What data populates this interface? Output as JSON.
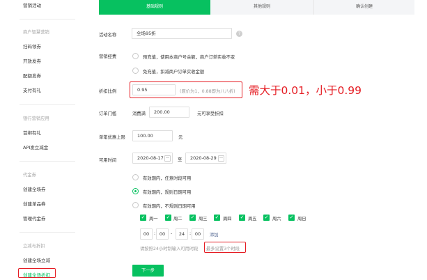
{
  "sidebar": {
    "top_item": "营销活动",
    "group1": {
      "title": "商户智慧营销",
      "items": [
        "扫码领券",
        "开放发券",
        "配额发券",
        "支付有礼"
      ]
    },
    "group2": {
      "title": "银行营销应用",
      "items": [
        "首绑有礼",
        "API发立减金"
      ]
    },
    "group3": {
      "title": "代金券",
      "items": [
        "创建全场券",
        "创建单品券",
        "管理代金券"
      ]
    },
    "group4": {
      "title": "立减与折扣",
      "items": [
        "创建全场立减",
        "创建全场折扣"
      ]
    }
  },
  "steps": [
    "基础规则",
    "其他规则",
    "确认创建"
  ],
  "form": {
    "activity_name": {
      "label": "活动名称",
      "value": "全场95折"
    },
    "funding": {
      "label": "营销经费",
      "options": [
        "预充值，使用本商户号余额，商户订单实收不变",
        "免充值，扣减商户订单实收金额"
      ]
    },
    "discount_ratio": {
      "label": "折扣比例",
      "value": "0.95",
      "hint": "(原价为1，0.88即为八八折)"
    },
    "annotation": "需大于0.01，小于0.99",
    "order_threshold": {
      "label": "订单门槛",
      "prefix": "消费满",
      "value": "200.00",
      "suffix": "元可享受折扣"
    },
    "max_discount": {
      "label": "单笔优惠上限",
      "value": "100.00",
      "unit": "元"
    },
    "available_time": {
      "label": "可用时间",
      "start": "2020-08-17",
      "to": "至",
      "end": "2020-08-29",
      "options": [
        "有效期内，任意时段可用",
        "有效期内，规则日期可用",
        "有效期内，不规则日期可用"
      ],
      "weekdays": [
        "周一",
        "周二",
        "周三",
        "周四",
        "周五",
        "周六",
        "周日"
      ],
      "time_start_h": "00",
      "time_start_m": "00",
      "time_dash": "-",
      "time_end_h": "24",
      "time_end_m": "00",
      "add_link": "添加",
      "tip": "请按照24小时制输入可用时段",
      "tip_limit": "最多设置3个时段"
    }
  },
  "next_button": "下一步",
  "colors": {
    "accent": "#07c160",
    "annotation_red": "#e51c23"
  },
  "icons": {
    "help": "help-circle-icon",
    "calendar": "calendar-icon",
    "check": "checkmark-icon"
  }
}
